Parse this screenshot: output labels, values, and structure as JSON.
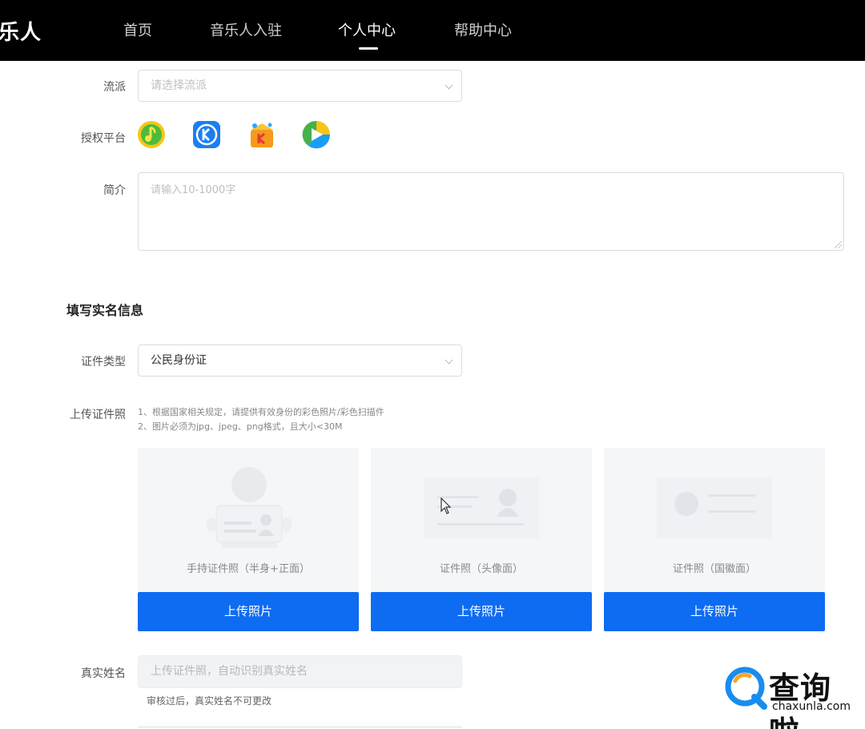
{
  "header": {
    "logo_text": "乐人",
    "nav": [
      {
        "label": "首页",
        "active": false
      },
      {
        "label": "音乐人入驻",
        "active": false
      },
      {
        "label": "个人中心",
        "active": true
      },
      {
        "label": "帮助中心",
        "active": false
      }
    ]
  },
  "form": {
    "genre": {
      "label": "流派",
      "placeholder": "请选择流派"
    },
    "platforms": {
      "label": "授权平台",
      "items": [
        {
          "icon": "qq-music-icon",
          "color": "#f5c518"
        },
        {
          "icon": "kugou-music-icon",
          "color": "#1a7ff0"
        },
        {
          "icon": "kuwo-karaoke-icon",
          "color": "#f59a1b"
        },
        {
          "icon": "kuwo-music-icon",
          "color": "#f5c518"
        }
      ]
    },
    "intro": {
      "label": "简介",
      "placeholder": "请输入10-1000字"
    }
  },
  "realname": {
    "title": "填写实名信息",
    "id_type": {
      "label": "证件类型",
      "value": "公民身份证"
    },
    "upload": {
      "label": "上传证件照",
      "hints": [
        "1、根据国家相关规定，请提供有效身份的彩色照片/彩色扫描件",
        "2、图片必须为jpg、jpeg、png格式，且大小<30M"
      ],
      "cards": [
        {
          "caption": "手持证件照（半身+正面）",
          "button": "上传照片"
        },
        {
          "caption": "证件照（头像面）",
          "button": "上传照片"
        },
        {
          "caption": "证件照（国徽面）",
          "button": "上传照片"
        }
      ]
    },
    "real_name": {
      "label": "真实姓名",
      "placeholder": "上传证件照，自动识别真实姓名",
      "note": "审核过后，真实姓名不可更改"
    }
  },
  "watermark": {
    "main": "查询啦",
    "sub": "chaxunla.com"
  },
  "colors": {
    "primary": "#0d6cf2",
    "nav_bg": "#000000",
    "card_bg": "#f5f6f8"
  }
}
